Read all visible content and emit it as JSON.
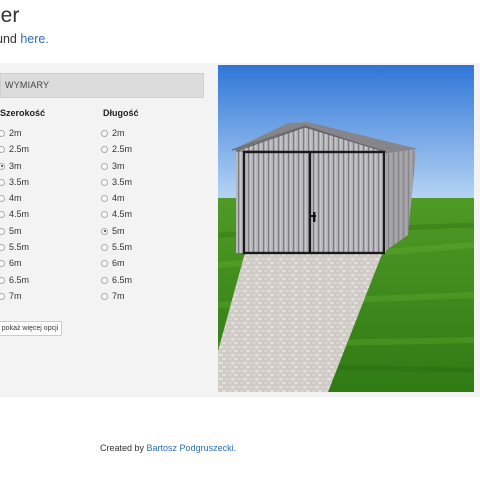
{
  "header": {
    "title": "ler",
    "subtitle_prefix": "und",
    "subtitle_link": "here."
  },
  "section": {
    "title": "WYMIARY"
  },
  "width_column": {
    "title": "Szerokość",
    "options": [
      "2m",
      "2.5m",
      "3m",
      "3.5m",
      "4m",
      "4.5m",
      "5m",
      "5.5m",
      "6m",
      "6.5m",
      "7m"
    ],
    "selected": "3m"
  },
  "length_column": {
    "title": "Długość",
    "options": [
      "2m",
      "2.5m",
      "3m",
      "3.5m",
      "4m",
      "4.5m",
      "5m",
      "5.5m",
      "6m",
      "6.5m",
      "7m"
    ],
    "selected": "5m"
  },
  "more_button": {
    "label": "pokaż więcej opcji"
  },
  "viewer": {
    "colors": {
      "sky_top": "#2f76d8",
      "sky_bottom": "#bcd9f5",
      "grass": "#3e8a1e",
      "garage_wall": "#a9a9ad",
      "garage_roof": "#8c8c90",
      "door_frame": "#1a1a1a",
      "path": "#c9c4bf"
    }
  },
  "footer": {
    "prefix": "Created by",
    "author": "Bartosz Podgruszecki."
  }
}
